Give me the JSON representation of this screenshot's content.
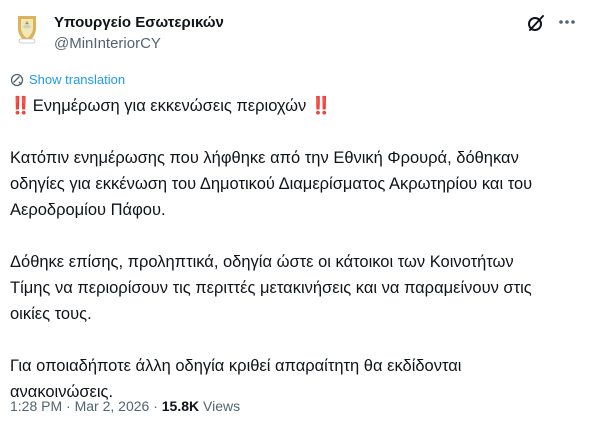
{
  "author": {
    "display_name": "Υπουργείο Εσωτερικών",
    "handle": "@MinInteriorCY",
    "avatar_icon": "cyprus-coat-of-arms"
  },
  "actions": {
    "grok_icon": "grok-icon",
    "more_icon": "more-icon"
  },
  "translation": {
    "label": "Show translation",
    "icon": "translate-globe-icon"
  },
  "tweet": {
    "heading_mark": "‼️",
    "heading": "Ενημέρωση για εκκενώσεις περιοχών",
    "line1": "Κατόπιν ενημέρωσης που λήφθηκε από την Εθνική Φρουρά, δόθηκαν",
    "line2": "οδηγίες για εκκένωση του Δημοτικού Διαμερίσματος Ακρωτηρίου και του",
    "line3": "Αεροδρομίου Πάφου.",
    "line4": "Δόθηκε επίσης, προληπτικά, οδηγία ώστε οι κάτοικοι των Κοινοτήτων",
    "line5": "Τίμης να περιορίσουν τις περιττές μετακινήσεις και να παραμείνουν στις",
    "line6": "οικίες τους.",
    "line7": "Για οποιαδήποτε άλλη οδηγία κριθεί απαραίτητη θα εκδίδονται",
    "line8": "ανακοινώσεις."
  },
  "meta": {
    "time": "1:28 PM",
    "separator": "·",
    "date": "Mar 2, 2026",
    "views_count": "15.8K",
    "views_label": "Views"
  },
  "colors": {
    "text": "#0f1419",
    "secondary": "#536471",
    "link": "#1d9bf0",
    "emoji_red": "#e0245e"
  }
}
